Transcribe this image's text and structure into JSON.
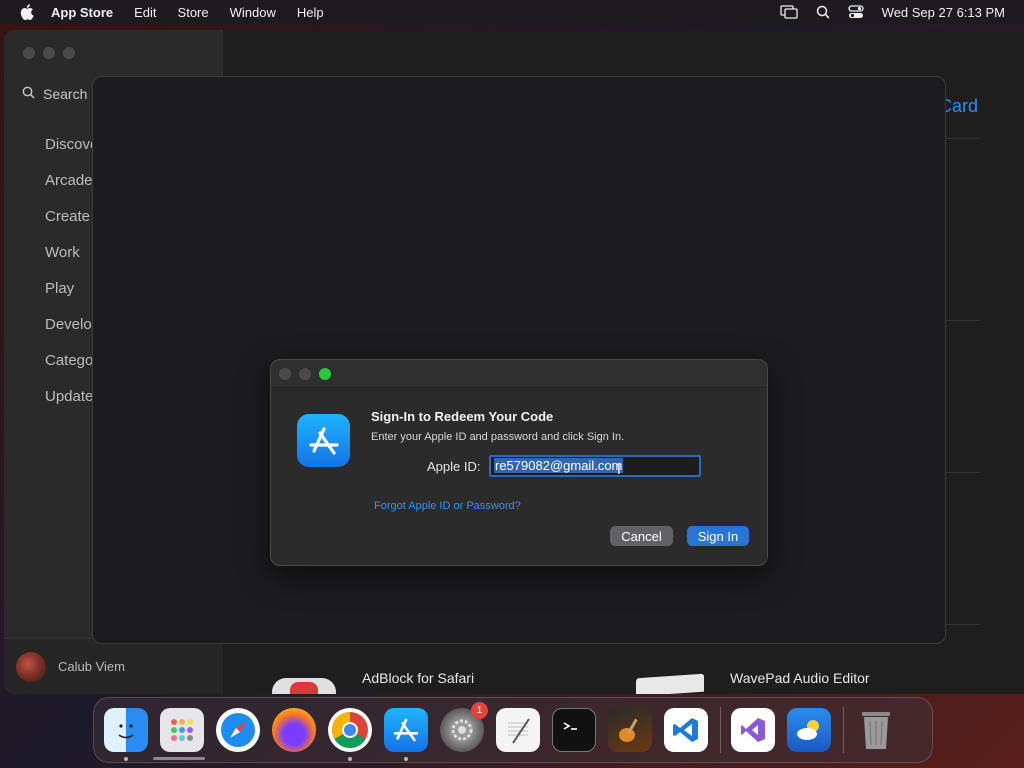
{
  "menubar": {
    "app_name": "App Store",
    "items": [
      "Edit",
      "Store",
      "Window",
      "Help"
    ],
    "datetime": "Wed Sep 27  6:13 PM"
  },
  "sidebar": {
    "search_label": "Search",
    "items": [
      "Discover",
      "Arcade",
      "Create",
      "Work",
      "Play",
      "Develop",
      "Categories",
      "Updates"
    ],
    "user_name": "Calub Viem"
  },
  "main": {
    "card_link": "Card",
    "bottom_apps": [
      "AdBlock for Safari",
      "WavePad Audio Editor"
    ]
  },
  "dialog": {
    "title": "Sign-In to Redeem Your Code",
    "subtitle": "Enter your Apple ID and password and click Sign In.",
    "apple_id_label": "Apple ID:",
    "apple_id_value": "re579082@gmail.com",
    "forgot_link": "Forgot Apple ID or Password?",
    "cancel_label": "Cancel",
    "signin_label": "Sign In"
  },
  "dock": {
    "apps": [
      "finder",
      "launchpad",
      "safari",
      "firefox",
      "chrome",
      "app-store",
      "system-settings",
      "textedit",
      "terminal",
      "garageband",
      "vscode",
      "visual-studio",
      "weather",
      "trash"
    ],
    "settings_badge": "1"
  },
  "colors": {
    "accent": "#2a74d6",
    "link": "#2f8cf5",
    "close": "#4a4a4a",
    "zoom": "#28c840"
  }
}
